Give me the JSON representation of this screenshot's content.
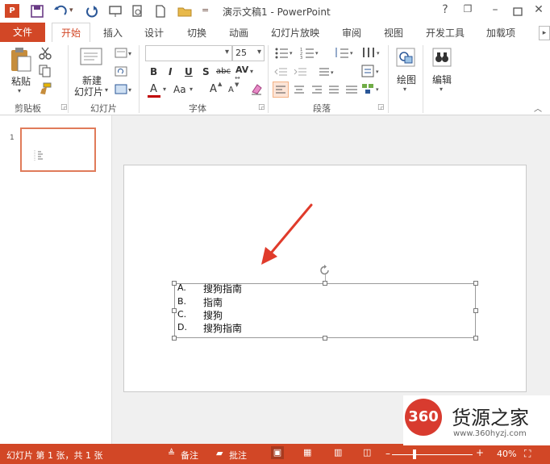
{
  "title": "演示文稿1 - PowerPoint",
  "window": {
    "help": "?",
    "minimize": "–",
    "restore": "❐",
    "close": "✕"
  },
  "quick_access": {
    "undo_arrow": "▾",
    "customize": "="
  },
  "tabs": [
    "文件",
    "开始",
    "插入",
    "设计",
    "切换",
    "动画",
    "幻灯片放映",
    "审阅",
    "视图",
    "开发工具",
    "加载项"
  ],
  "ribbon": {
    "clipboard": {
      "paste": "粘贴",
      "label": "剪贴板"
    },
    "slides": {
      "new_slide_line1": "新建",
      "new_slide_line2": "幻灯片",
      "label": "幻灯片"
    },
    "font": {
      "font_name": "",
      "font_size": "25",
      "bold": "B",
      "italic": "I",
      "underline": "U",
      "strike": "S",
      "shadow": "abc",
      "char_spacing": "AV",
      "font_color": "A",
      "case": "Aa",
      "grow": "A",
      "shrink": "A",
      "label": "字体"
    },
    "paragraph": {
      "label": "段落"
    },
    "drawing": {
      "label": "绘图"
    },
    "editing": {
      "label": "编辑"
    }
  },
  "thumbnail": {
    "number": "1"
  },
  "slide": {
    "list": [
      {
        "letter": "A.",
        "text": "搜狗指南"
      },
      {
        "letter": "B.",
        "text": "指南"
      },
      {
        "letter": "C.",
        "text": "搜狗"
      },
      {
        "letter": "D.",
        "text": "搜狗指南"
      }
    ]
  },
  "status": {
    "slide_info": "幻灯片 第 1 张，共 1 张",
    "notes": "备注",
    "comments": "批注",
    "zoom": "40%"
  },
  "watermark": {
    "logo": "360",
    "brand": "货源之家",
    "url": "www.360hyzj.com"
  },
  "colors": {
    "accent": "#d24726",
    "arrow": "#e03b2b"
  }
}
